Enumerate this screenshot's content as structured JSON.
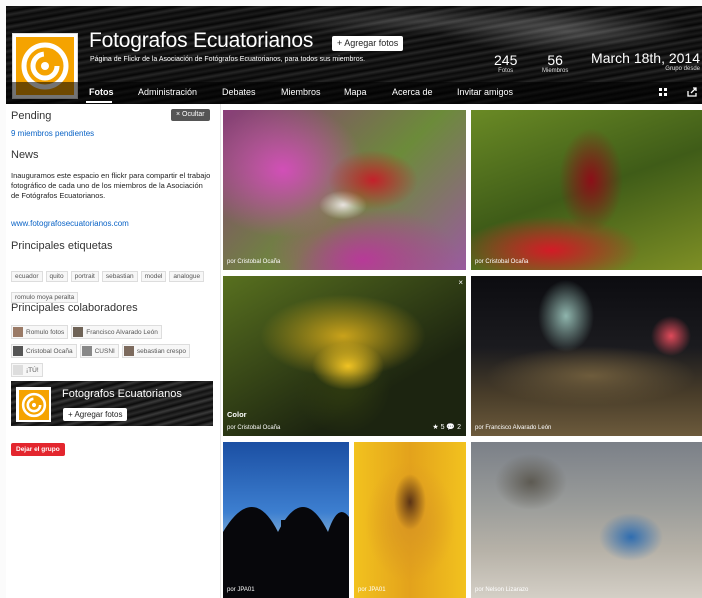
{
  "group": {
    "title": "Fotografos Ecuatorianos",
    "add_photos": "+ Agregar fotos",
    "description": "Página de Flickr de la Asociación de Fotógrafos Ecuatorianos, para todos sus miembros.",
    "stats": [
      {
        "num": "245",
        "label": "Fotos"
      },
      {
        "num": "56",
        "label": "Miembros"
      }
    ],
    "since": {
      "date": "March 18th, 2014",
      "label": "Grupo desde"
    }
  },
  "nav": {
    "items": [
      "Fotos",
      "Administración",
      "Debates",
      "Miembros",
      "Mapa",
      "Acerca de",
      "Invitar amigos"
    ],
    "icons": [
      "grid-icon",
      "share-icon"
    ]
  },
  "sidebar": {
    "pending_heading": "Pending",
    "hide_label": "× Ocultar",
    "pending_link": "9 miembros pendientes",
    "news_heading": "News",
    "news_text": "Inauguramos este espacio en flickr para compartir el trabajo fotográfico de cada uno de los miembros de la Asociación de Fotógrafos Ecuatorianos.",
    "news_link": "www.fotografosecuatorianos.com",
    "tags_heading": "Principales etiquetas",
    "tags": [
      "ecuador",
      "quito",
      "portrait",
      "sebastian",
      "model",
      "analogue",
      "romulo moya peralta"
    ],
    "collab_heading": "Principales colaboradores",
    "collaborators": [
      "Romulo fotos",
      "Francisco Alvarado León",
      "Cristobal Ocaña",
      "CUSNI",
      "sebastian crespo",
      "¡TÚ!"
    ],
    "promo": {
      "title": "Fotografos Ecuatorianos",
      "button": "+ Agregar fotos"
    },
    "leave_label": "Dejar el grupo"
  },
  "photos": [
    {
      "caption": "por Cristobal Ocaña"
    },
    {
      "caption": "por Cristobal Ocaña"
    },
    {
      "caption": "por Cristobal Ocaña",
      "title": "Color",
      "stats": "★ 5  💬 2",
      "close": "×"
    },
    {
      "caption": "por Francisco Alvarado León"
    },
    {
      "caption": "por JPA01"
    },
    {
      "caption": "por JPA01"
    },
    {
      "caption": "por Nelson Lizarazo"
    }
  ],
  "colors": {
    "accent": "#f5a300",
    "link": "#0a63c6",
    "leave": "#e3262e"
  }
}
